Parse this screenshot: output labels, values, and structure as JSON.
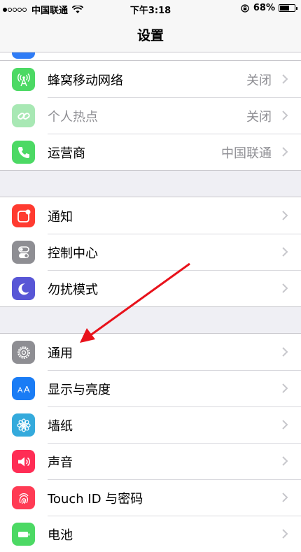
{
  "status_bar": {
    "signal_dots_filled": 1,
    "signal_dots_total": 5,
    "carrier": "中国联通",
    "time": "下午3:18",
    "battery_text": "68%",
    "battery_level": 0.68
  },
  "nav": {
    "title": "设置"
  },
  "group1": [
    {
      "label": "蜂窝移动网络",
      "value": "关闭",
      "icon": "cellular-antenna-icon",
      "color": "#4cd964"
    },
    {
      "label": "个人热点",
      "value": "关闭",
      "icon": "hotspot-chain-icon",
      "color": "#a8e8b4"
    },
    {
      "label": "运营商",
      "value": "中国联通",
      "icon": "phone-icon",
      "color": "#4cd964"
    }
  ],
  "group2": [
    {
      "label": "通知",
      "icon": "notification-icon",
      "color": "#ff3b30"
    },
    {
      "label": "控制中心",
      "icon": "toggle-switches-icon",
      "color": "#8e8e93"
    },
    {
      "label": "勿扰模式",
      "icon": "moon-icon",
      "color": "#5856d6"
    }
  ],
  "group3": [
    {
      "label": "通用",
      "icon": "gear-icon",
      "color": "#8e8e93"
    },
    {
      "label": "显示与亮度",
      "icon": "text-size-icon",
      "color": "#1a7cf5"
    },
    {
      "label": "墙纸",
      "icon": "flower-icon",
      "color": "#34aadc"
    },
    {
      "label": "声音",
      "icon": "speaker-icon",
      "color": "#ff2d55"
    },
    {
      "label": "Touch ID 与密码",
      "icon": "fingerprint-icon",
      "color": "#ff3b54"
    },
    {
      "label": "电池",
      "icon": "battery-icon",
      "color": "#4cd964"
    }
  ],
  "annotation": {
    "color": "#e8121b",
    "icon": "red-arrow-icon"
  }
}
